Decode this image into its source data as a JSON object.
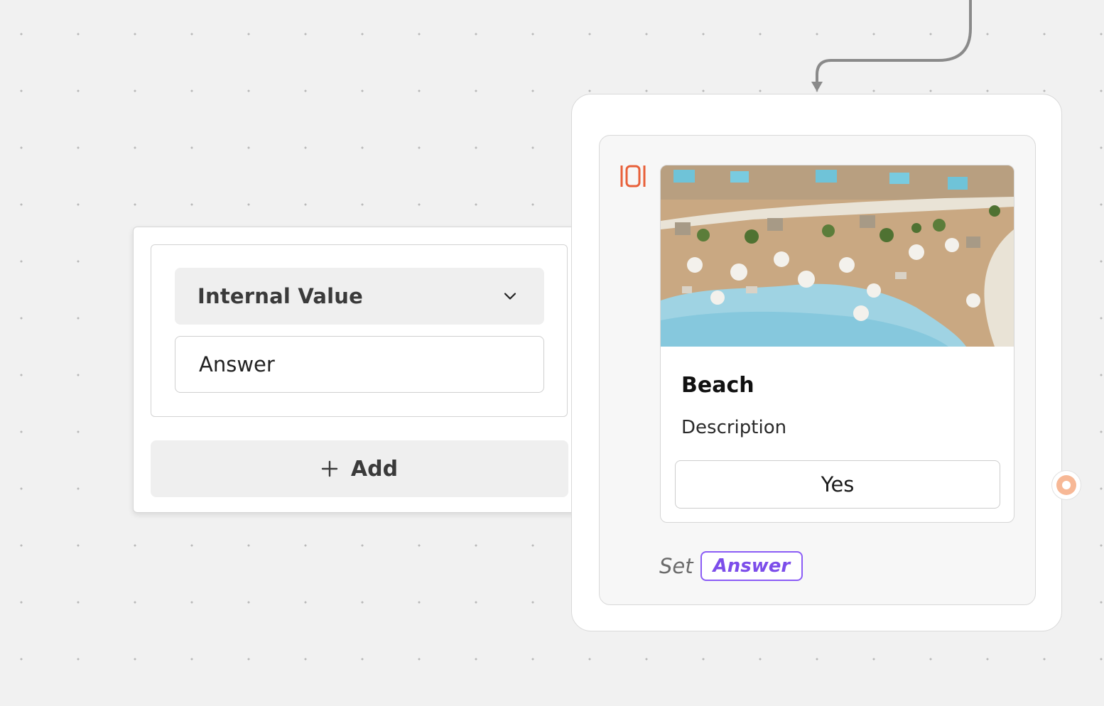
{
  "popover": {
    "select_label": "Internal Value",
    "answer_value": "Answer",
    "add_label": "Add"
  },
  "node": {
    "card_title": "Beach",
    "card_description": "Description",
    "card_button_label": "Yes",
    "set_label": "Set",
    "variable_name": "Answer"
  },
  "colors": {
    "canvas_bg": "#f1f1f1",
    "accent_orange": "#e8603a",
    "variable_purple": "#8b5cf6",
    "edge_gray": "#8a8a8a"
  },
  "icons": {
    "select_chevron": "chevron-down-icon",
    "add": "plus-icon",
    "block_type": "carousel-icon",
    "edge_end": "arrow-down-icon"
  }
}
